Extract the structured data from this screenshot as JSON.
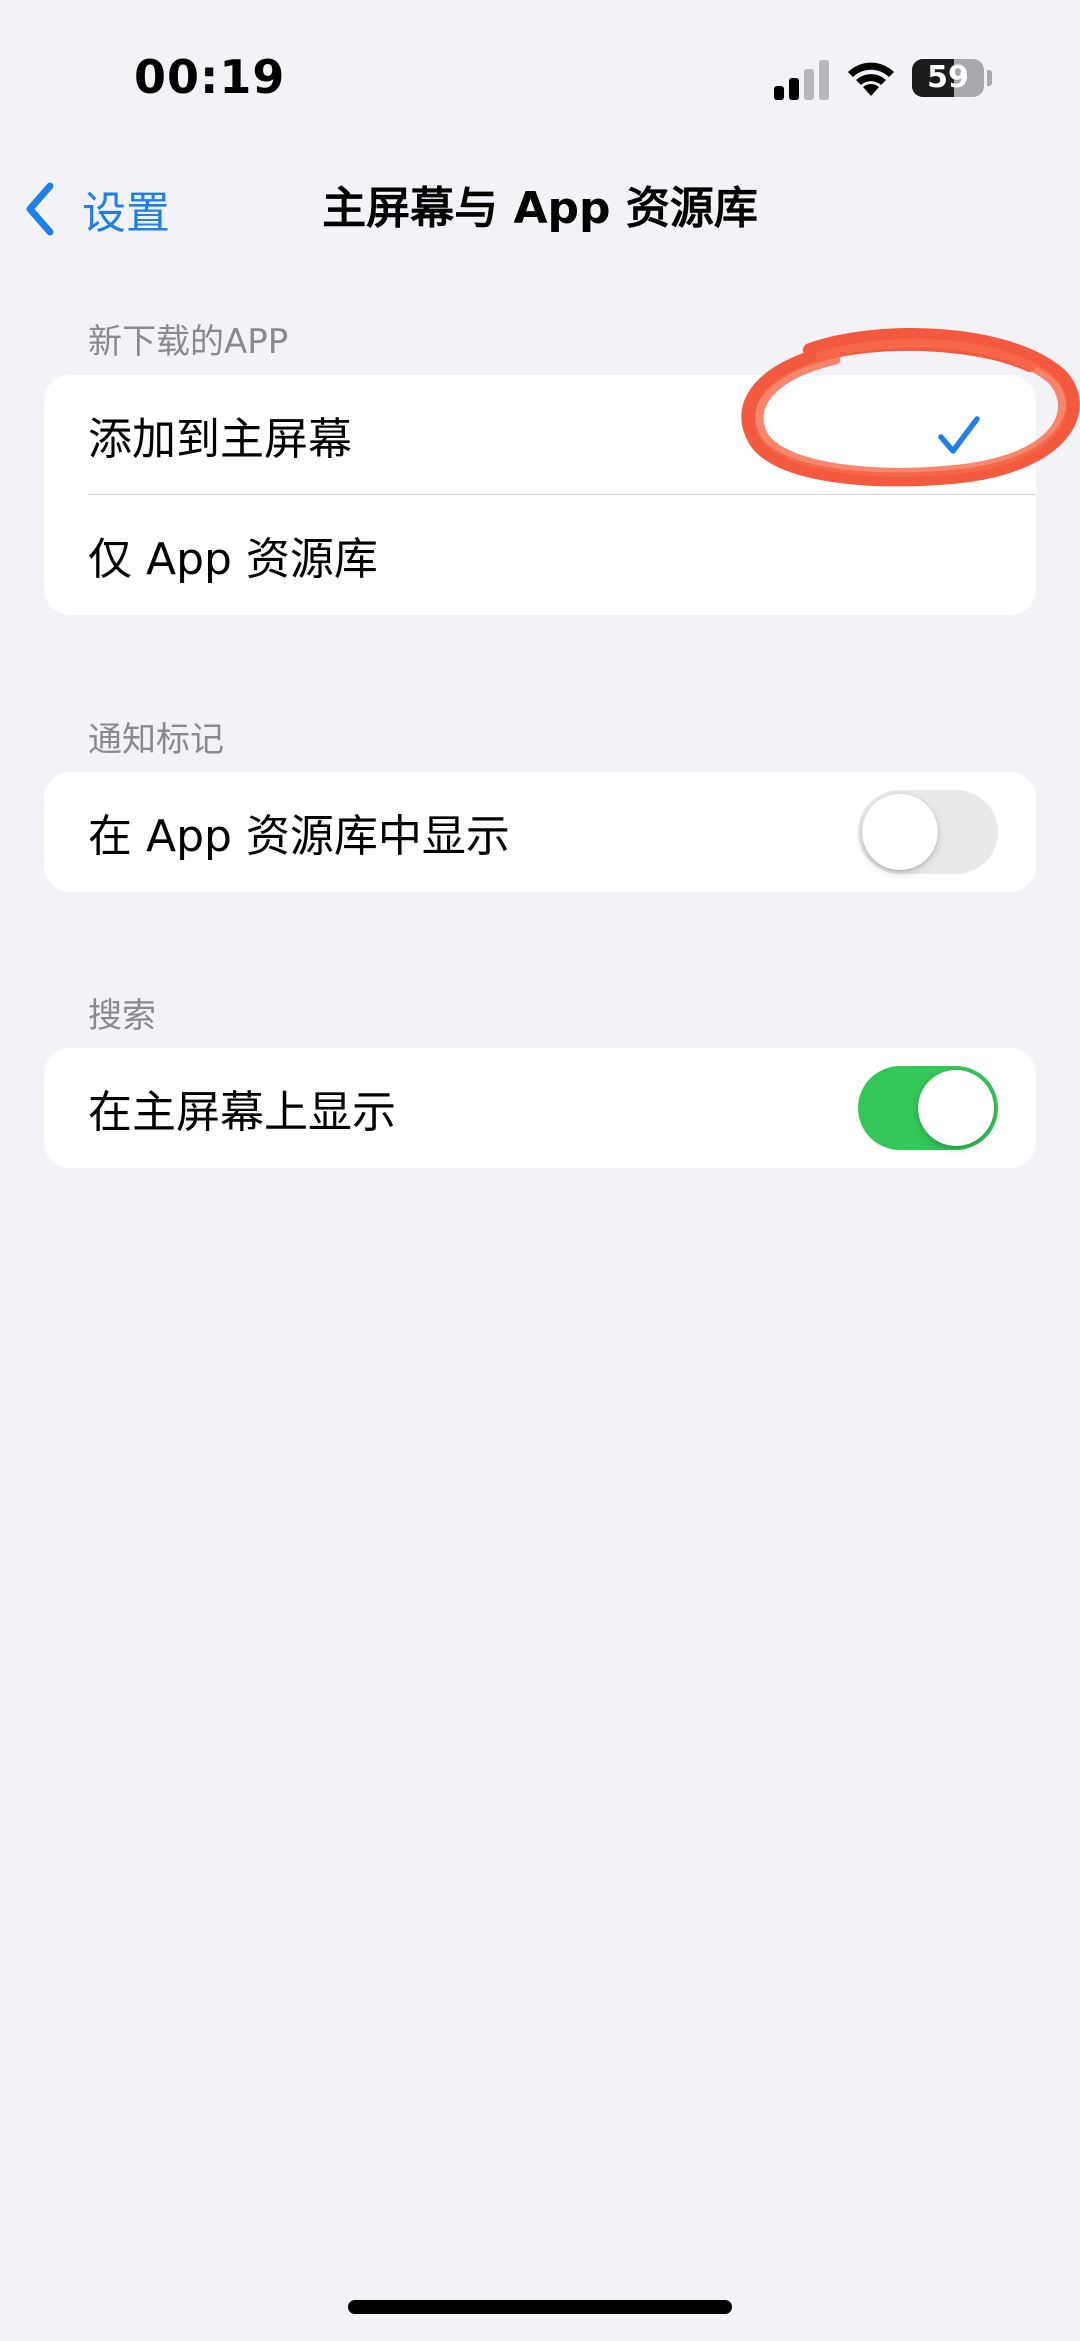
{
  "status_bar": {
    "time": "00:19",
    "battery_percent": 59,
    "battery_label": "59",
    "signal_bars_active": 2,
    "signal_bars_total": 4
  },
  "nav": {
    "back_label": "设置",
    "title": "主屏幕与 App 资源库"
  },
  "sections": [
    {
      "header": "新下载的APP",
      "rows": [
        {
          "label": "添加到主屏幕",
          "checked": true
        },
        {
          "label": "仅 App 资源库",
          "checked": false
        }
      ]
    },
    {
      "header": "通知标记",
      "rows": [
        {
          "label": "在 App 资源库中显示",
          "toggle": false
        }
      ]
    },
    {
      "header": "搜索",
      "rows": [
        {
          "label": "在主屏幕上显示",
          "toggle": true
        }
      ]
    }
  ],
  "colors": {
    "background": "#f2f2f7",
    "accent": "#1e80e8",
    "toggle_on": "#34c759",
    "toggle_off": "#e9e9eb",
    "annotation": "#f2482a"
  },
  "icons": {
    "back": "chevron-left-icon",
    "check": "checkmark-icon",
    "wifi": "wifi-icon",
    "signal": "cellular-signal-icon",
    "battery": "battery-icon"
  }
}
